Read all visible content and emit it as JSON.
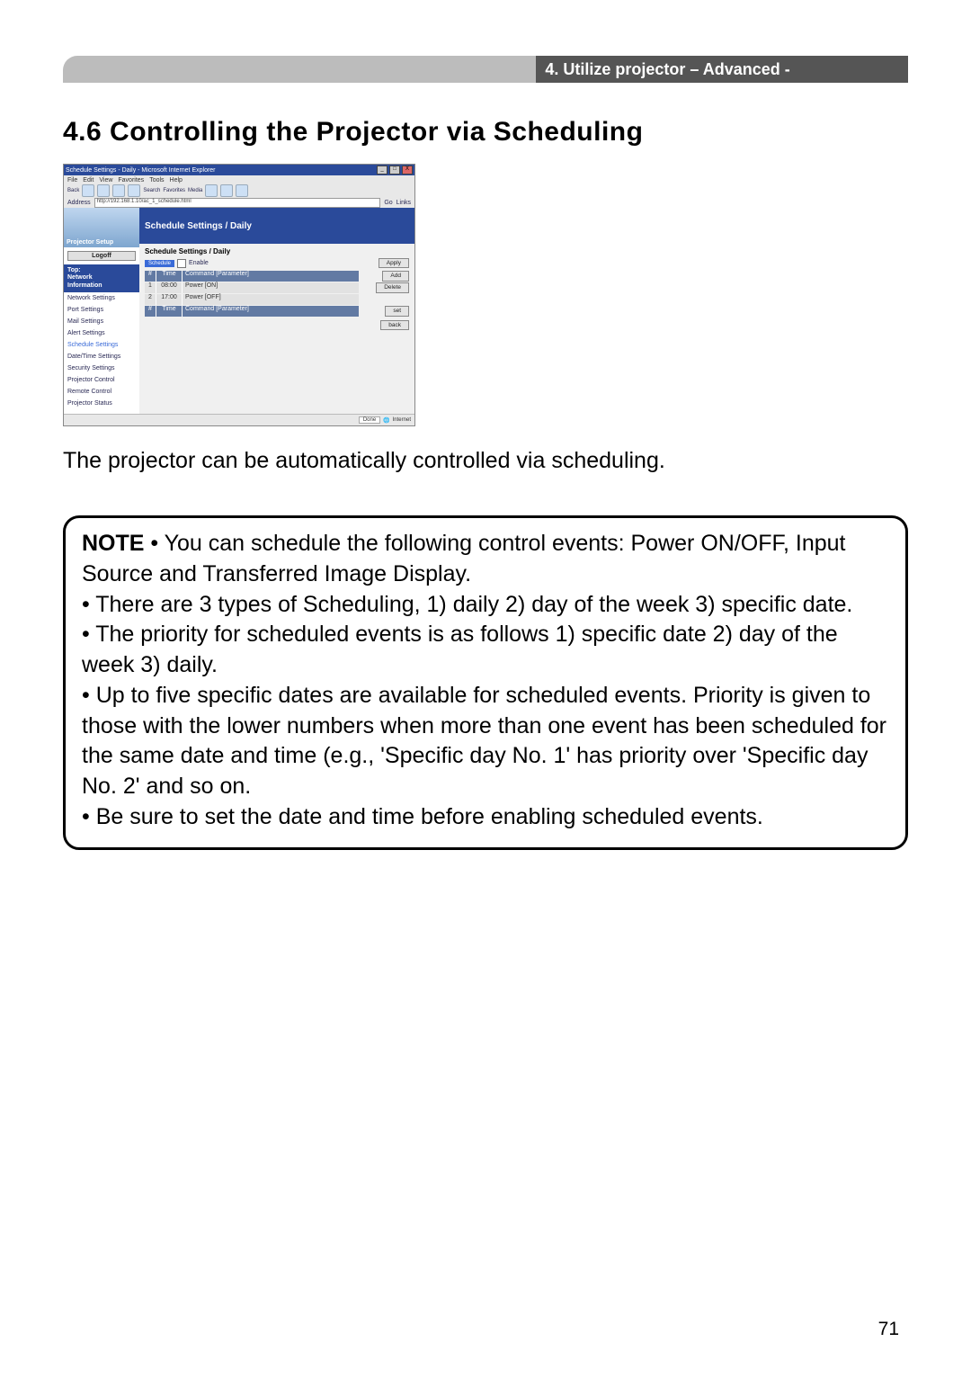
{
  "header": {
    "breadcrumb": "4. Utilize projector – Advanced -"
  },
  "section": {
    "title": "4.6 Controlling the Projector via Scheduling"
  },
  "screenshot": {
    "window_title": "Schedule Settings - Daily - Microsoft Internet Explorer",
    "menu": [
      "File",
      "Edit",
      "View",
      "Favorites",
      "Tools",
      "Help"
    ],
    "toolbar_labels": [
      "Back",
      "",
      "",
      "",
      "Search",
      "Favorites",
      "Media",
      "",
      "",
      ""
    ],
    "address_label": "Address",
    "address_value": "http://192.168.1.10/ac_1_schedule.html",
    "address_go": "Go",
    "address_links": "Links",
    "sidebar": {
      "brand": "Projector Setup",
      "logoff": "Logoff",
      "top_block": "Top:\nNetwork\nInformation",
      "items": [
        "Network Settings",
        "Port Settings",
        "Mail Settings",
        "Alert Settings",
        "Schedule Settings",
        "Date/Time Settings",
        "Security Settings",
        "Projector Control",
        "Remote Control",
        "Projector Status"
      ],
      "selected_index": 4
    },
    "main": {
      "title": "Schedule Settings / Daily",
      "subtitle": "Schedule Settings / Daily",
      "enable_tag": "Schedule",
      "enable_label": "Enable",
      "apply_btn": "Apply",
      "header_row": {
        "num": "#",
        "time": "Time",
        "cmd": "Command [Parameter]"
      },
      "rows": [
        {
          "num": "1",
          "time": "08:00",
          "cmd": "Power [ON]",
          "btn": "Add"
        },
        {
          "num": "2",
          "time": "17:00",
          "cmd": "Power [OFF]",
          "btn": "Delete"
        }
      ],
      "footer_row": {
        "num": "#",
        "time": "Time",
        "cmd": "Command [Parameter]",
        "btn": "set"
      },
      "back_btn": "back"
    },
    "status": {
      "zone": "Internet",
      "done": "Done"
    }
  },
  "intro": "The projector can be automatically controlled via scheduling.",
  "note": {
    "label": "NOTE",
    "l1": " • You can schedule the following control events: Power ON/OFF, Input Source and Transferred Image Display.",
    "l2": "• There are 3 types of Scheduling, 1) daily 2) day of the week 3) specific date.",
    "l3": "• The priority for scheduled events is as follows 1) specific date 2) day of the week 3) daily.",
    "l4": "• Up to five specific dates are available for scheduled events. Priority is given to those with the lower numbers when more than one event has been scheduled for the same date and time (e.g., 'Specific day No. 1' has priority over 'Specific day No. 2' and so on.",
    "l5": "• Be sure to set the date and time before enabling scheduled events."
  },
  "page_number": "71"
}
